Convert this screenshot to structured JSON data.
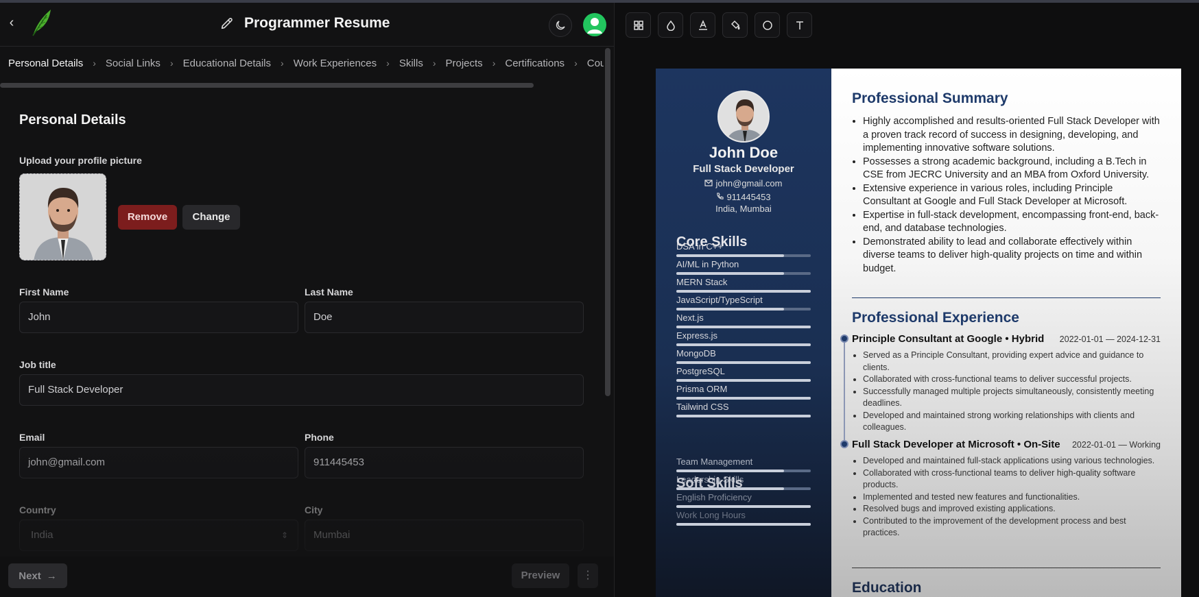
{
  "header": {
    "title": "Programmer Resume"
  },
  "breadcrumb": [
    "Personal Details",
    "Social Links",
    "Educational Details",
    "Work Experiences",
    "Skills",
    "Projects",
    "Certifications",
    "Cou"
  ],
  "form": {
    "section_title": "Personal Details",
    "upload_label": "Upload your profile picture",
    "remove_label": "Remove",
    "change_label": "Change",
    "first_name_label": "First Name",
    "first_name_value": "John",
    "last_name_label": "Last Name",
    "last_name_value": "Doe",
    "job_title_label": "Job title",
    "job_title_value": "Full Stack Developer",
    "email_label": "Email",
    "email_value": "john@gmail.com",
    "phone_label": "Phone",
    "phone_value": "911445453",
    "country_label": "Country",
    "country_value": "India",
    "city_label": "City",
    "city_value": "Mumbai"
  },
  "footer": {
    "next_label": "Next",
    "preview_label": "Preview"
  },
  "toolbar_icons": [
    "layout-grid-icon",
    "droplet-icon",
    "font-color-icon",
    "paint-bucket-icon",
    "circle-icon",
    "text-icon"
  ],
  "resume": {
    "name": "John Doe",
    "role": "Full Stack Developer",
    "email": "john@gmail.com",
    "phone": "911445453",
    "location": "India, Mumbai",
    "core_skills_title": "Core Skills",
    "core_skills": [
      {
        "name": "DSA in C++",
        "level": 0.8
      },
      {
        "name": "AI/ML in Python",
        "level": 0.8
      },
      {
        "name": "MERN Stack",
        "level": 1.0
      },
      {
        "name": "JavaScript/TypeScript",
        "level": 0.8
      },
      {
        "name": "Next.js",
        "level": 1.0
      },
      {
        "name": "Express.js",
        "level": 1.0
      },
      {
        "name": "MongoDB",
        "level": 1.0
      },
      {
        "name": "PostgreSQL",
        "level": 1.0
      },
      {
        "name": "Prisma ORM",
        "level": 1.0
      },
      {
        "name": "Tailwind CSS",
        "level": 1.0
      }
    ],
    "soft_skills_title": "Soft Skills",
    "soft_skills": [
      {
        "name": "Team Management",
        "level": 0.8
      },
      {
        "name": "Leadership Skills",
        "level": 0.8
      },
      {
        "name": "English Proficiency",
        "level": 1.0
      },
      {
        "name": "Work Long Hours",
        "level": 1.0
      }
    ],
    "summary_title": "Professional Summary",
    "summary": [
      "Highly accomplished and results-oriented Full Stack Developer with a proven track record of success in designing, developing, and implementing innovative software solutions.",
      "Possesses a strong academic background, including a B.Tech in CSE from JECRC University and an MBA from Oxford University.",
      "Extensive experience in various roles, including Principle Consultant at Google and Full Stack Developer at Microsoft.",
      "Expertise in full-stack development, encompassing front-end, back-end, and database technologies.",
      "Demonstrated ability to lead and collaborate effectively within diverse teams to deliver high-quality projects on time and within budget."
    ],
    "experience_title": "Professional Experience",
    "experience": [
      {
        "title": "Principle Consultant at Google • Hybrid",
        "dates": "2022-01-01 — 2024-12-31",
        "points": [
          "Served as a Principle Consultant, providing expert advice and guidance to clients.",
          "Collaborated with cross-functional teams to deliver successful projects.",
          "Successfully managed multiple projects simultaneously, consistently meeting deadlines.",
          "Developed and maintained strong working relationships with clients and colleagues."
        ]
      },
      {
        "title": "Full Stack Developer at Microsoft • On-Site",
        "dates": "2022-01-01 — Working",
        "points": [
          "Developed and maintained full-stack applications using various technologies.",
          "Collaborated with cross-functional teams to deliver high-quality software products.",
          "Implemented and tested new features and functionalities.",
          "Resolved bugs and improved existing applications.",
          "Contributed to the improvement of the development process and best practices."
        ]
      }
    ],
    "education_title": "Education"
  },
  "colors": {
    "accent_danger": "#7c1d1d",
    "avatar_green": "#22c55e",
    "resume_sidebar": "#1d355f",
    "resume_heading": "#1e3a6a"
  }
}
